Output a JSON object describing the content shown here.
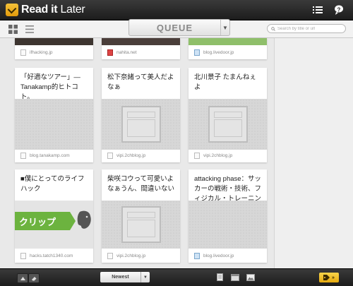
{
  "app": {
    "logo_read": "Read",
    "logo_it": "it",
    "logo_later": "Later"
  },
  "toolbar": {
    "queue_label": "QUEUE",
    "search_placeholder": "Search by title or url"
  },
  "cards": [
    {
      "title": "",
      "domain": "ifhacking.jp",
      "image": "photo-dark"
    },
    {
      "title": "",
      "domain": "nahita.net",
      "image": "photo-dark"
    },
    {
      "title": "",
      "domain": "blog.livedoor.jp",
      "image": "photo-green"
    },
    {
      "title": "「好適なツアー」— Tanakamp的ヒトコト。",
      "domain": "blog.tanakamp.com",
      "image": "blank"
    },
    {
      "title": "松下奈緒って美人だよなぁ",
      "domain": "vipi.2chblog.jp",
      "image": "placeholder"
    },
    {
      "title": "北川景子 たまんねぇよ",
      "domain": "vipi.2chblog.jp",
      "image": "placeholder"
    },
    {
      "title": "■僕にとってのライフハック",
      "domain": "hacks.tatch1340.com",
      "image": "clip",
      "image_text": "クリップ"
    },
    {
      "title": "柴咲コウって可愛いよなぁうん、間違いない",
      "domain": "vipi.2chblog.jp",
      "image": "placeholder"
    },
    {
      "title": "attacking phase：サッカーの戦術・技術、フィジカル・トレーニング、フ",
      "domain": "blog.livedoor.jp",
      "image": "blank"
    }
  ],
  "bottom": {
    "sort_label": "Newest"
  },
  "colors": {
    "accent": "#f0b520",
    "bar_dark": "#262626",
    "clip_green": "#6cb33f"
  }
}
